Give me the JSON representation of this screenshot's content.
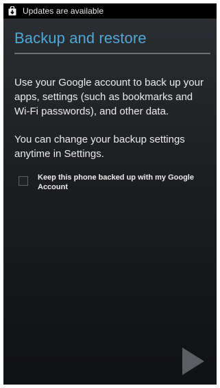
{
  "status_bar": {
    "notification_icon": "download-bag-icon",
    "text": "Updates are available"
  },
  "page": {
    "title": "Backup and restore",
    "paragraph_1": "Use your Google account to back up your apps, settings (such as bookmarks and Wi-Fi passwords), and other data.",
    "paragraph_2": "You can change your backup settings anytime in Settings."
  },
  "backup_option": {
    "label": "Keep this phone backed up with my Google Account",
    "checked": false
  },
  "navigation": {
    "next_icon": "next-arrow-icon"
  },
  "colors": {
    "title_accent": "#4fa8d6",
    "background": "#1c1e21",
    "status_bar": "#000000"
  }
}
